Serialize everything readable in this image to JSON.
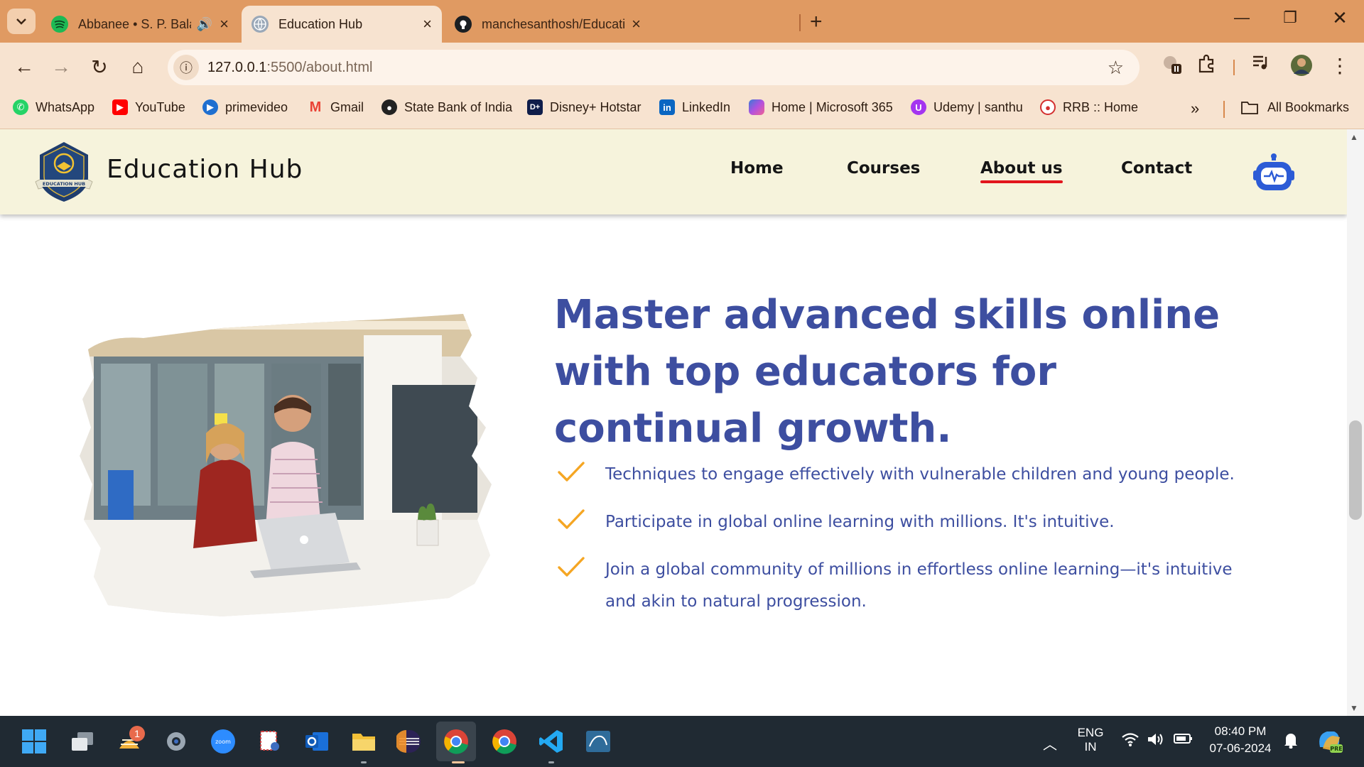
{
  "browser": {
    "tabs": [
      {
        "title": "Abbanee • S. P. Balasubrahmanyam",
        "active": false,
        "audio": true
      },
      {
        "title": "Education Hub",
        "active": true,
        "audio": false
      },
      {
        "title": "manchesanthosh/Education-Hub",
        "active": false,
        "audio": false
      }
    ],
    "url_host": "127.0.0.1",
    "url_rest": ":5500/about.html",
    "bookmarks": [
      {
        "label": "WhatsApp",
        "icon": "whatsapp-icon",
        "color": "#25d366"
      },
      {
        "label": "YouTube",
        "icon": "youtube-icon",
        "color": "#ff0000"
      },
      {
        "label": "primevideo",
        "icon": "primevideo-icon",
        "color": "#1f6fd0"
      },
      {
        "label": "Gmail",
        "icon": "gmail-icon",
        "color": "#ea4335"
      },
      {
        "label": "State Bank of India",
        "icon": "sbi-icon",
        "color": "#222222"
      },
      {
        "label": "Disney+ Hotstar",
        "icon": "hotstar-icon",
        "color": "#0f1d4a"
      },
      {
        "label": "LinkedIn",
        "icon": "linkedin-icon",
        "color": "#0a66c2"
      },
      {
        "label": "Home | Microsoft 365",
        "icon": "microsoft365-icon",
        "color": "#7a5bd8"
      },
      {
        "label": "Udemy | santhu",
        "icon": "udemy-icon",
        "color": "#a435f0"
      },
      {
        "label": "RRB :: Home",
        "icon": "rrb-icon",
        "color": "#d32f2f"
      }
    ],
    "all_bookmarks": "All Bookmarks"
  },
  "site": {
    "brand": "Education Hub",
    "logo_text": "EDUCATION HUB",
    "nav": [
      {
        "label": "Home",
        "active": false
      },
      {
        "label": "Courses",
        "active": false
      },
      {
        "label": "About us",
        "active": true
      },
      {
        "label": "Contact",
        "active": false
      }
    ],
    "headline": "Master advanced skills online with top educators for continual growth.",
    "features": [
      "Techniques to engage effectively with vulnerable children and young people.",
      "Participate in global online learning with millions. It's intuitive.",
      "Join a global community of millions in effortless online learning—it's intuitive and akin to natural progression."
    ],
    "colors": {
      "accent": "#3d4ea0",
      "check": "#f5a623",
      "header_bg": "#f6f3dc",
      "nav_underline": "#e2151d"
    }
  },
  "taskbar": {
    "badge": "1",
    "lang_top": "ENG",
    "lang_bottom": "IN",
    "time": "08:40 PM",
    "date": "07-06-2024",
    "colors": {
      "bar": "#202a33",
      "accent": "#9aa3aa"
    }
  }
}
